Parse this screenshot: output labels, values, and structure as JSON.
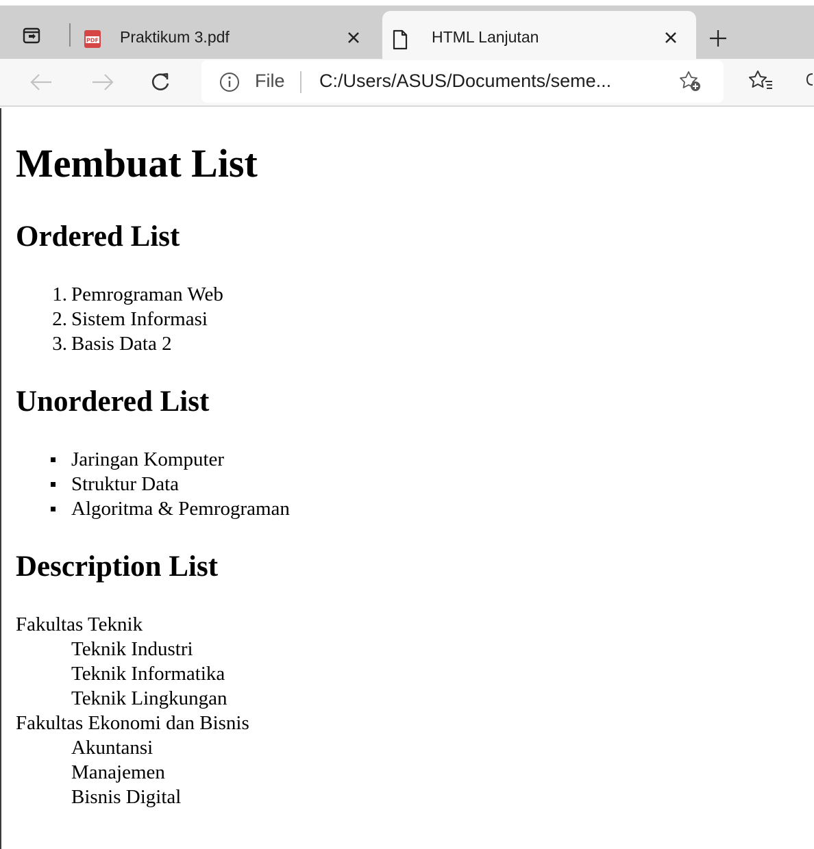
{
  "browser": {
    "tabs": [
      {
        "title": "Praktikum 3.pdf",
        "icon": "pdf-icon",
        "active": false
      },
      {
        "title": "HTML Lanjutan",
        "icon": "page-icon",
        "active": true
      }
    ],
    "address_bar": {
      "scheme_label": "File",
      "url": "C:/Users/ASUS/Documents/seme..."
    }
  },
  "page": {
    "heading": "Membuat List",
    "ordered": {
      "heading": "Ordered List",
      "items": [
        {
          "marker": "1.",
          "text": "Pemrograman Web"
        },
        {
          "marker": "2.",
          "text": "Sistem Informasi"
        },
        {
          "marker": "3.",
          "text": "Basis Data 2"
        }
      ]
    },
    "unordered": {
      "heading": "Unordered List",
      "items": [
        "Jaringan Komputer",
        "Struktur Data",
        "Algoritma & Pemrograman"
      ]
    },
    "description": {
      "heading": "Description List",
      "groups": [
        {
          "term": "Fakultas Teknik",
          "details": [
            "Teknik Industri",
            "Teknik Informatika",
            "Teknik Lingkungan"
          ]
        },
        {
          "term": "Fakultas Ekonomi dan Bisnis",
          "details": [
            "Akuntansi",
            "Manajemen",
            "Bisnis Digital"
          ]
        }
      ]
    }
  }
}
